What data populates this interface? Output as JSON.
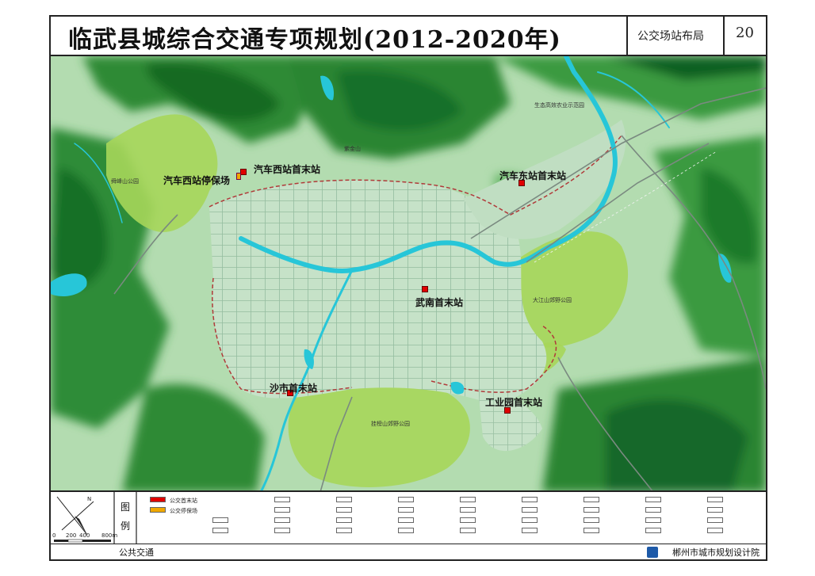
{
  "title": {
    "main": "临武县城综合交通专项规划(2012-2020年)",
    "sheet_name": "公交场站布局",
    "sheet_number": "20"
  },
  "map": {
    "stations": [
      {
        "id": "west-terminal",
        "label": "汽车西站首末站"
      },
      {
        "id": "west-parking",
        "label": "汽车西站停保场"
      },
      {
        "id": "east-terminal",
        "label": "汽车东站首末站"
      },
      {
        "id": "wunan-terminal",
        "label": "武南首末站"
      },
      {
        "id": "shashi-terminal",
        "label": "沙市首末站"
      },
      {
        "id": "industrial-terminal",
        "label": "工业园首末站"
      }
    ],
    "parks": [
      {
        "id": "west-park",
        "label": "舜峰山公园"
      },
      {
        "id": "dajiang-park",
        "label": "大江山郊野公园"
      },
      {
        "id": "guabang-park",
        "label": "挂榜山郊野公园"
      }
    ],
    "small_labels": {
      "north_area": "生态高效农业示范园",
      "mountain": "紫金山"
    },
    "colors": {
      "dark_green": "#1f7a2a",
      "mid_green": "#4aa84a",
      "light_green": "#a8d8a0",
      "park_green": "#a6d65a",
      "urban": "#bcdcc0",
      "river": "#27c6d8",
      "station_red": "#e00000",
      "parking_orange": "#f0a800"
    }
  },
  "legend": {
    "heading_chars": [
      "图",
      "例"
    ],
    "items": [
      {
        "label": "公交首末站",
        "color": "#e00000"
      },
      {
        "label": "公交停保场",
        "color": "#f0a800"
      }
    ],
    "scale_ticks": [
      "0",
      "200",
      "400",
      "800m"
    ],
    "north_mark": "N"
  },
  "footer": {
    "left": "公共交通",
    "right": "郴州市城市规划设计院"
  }
}
